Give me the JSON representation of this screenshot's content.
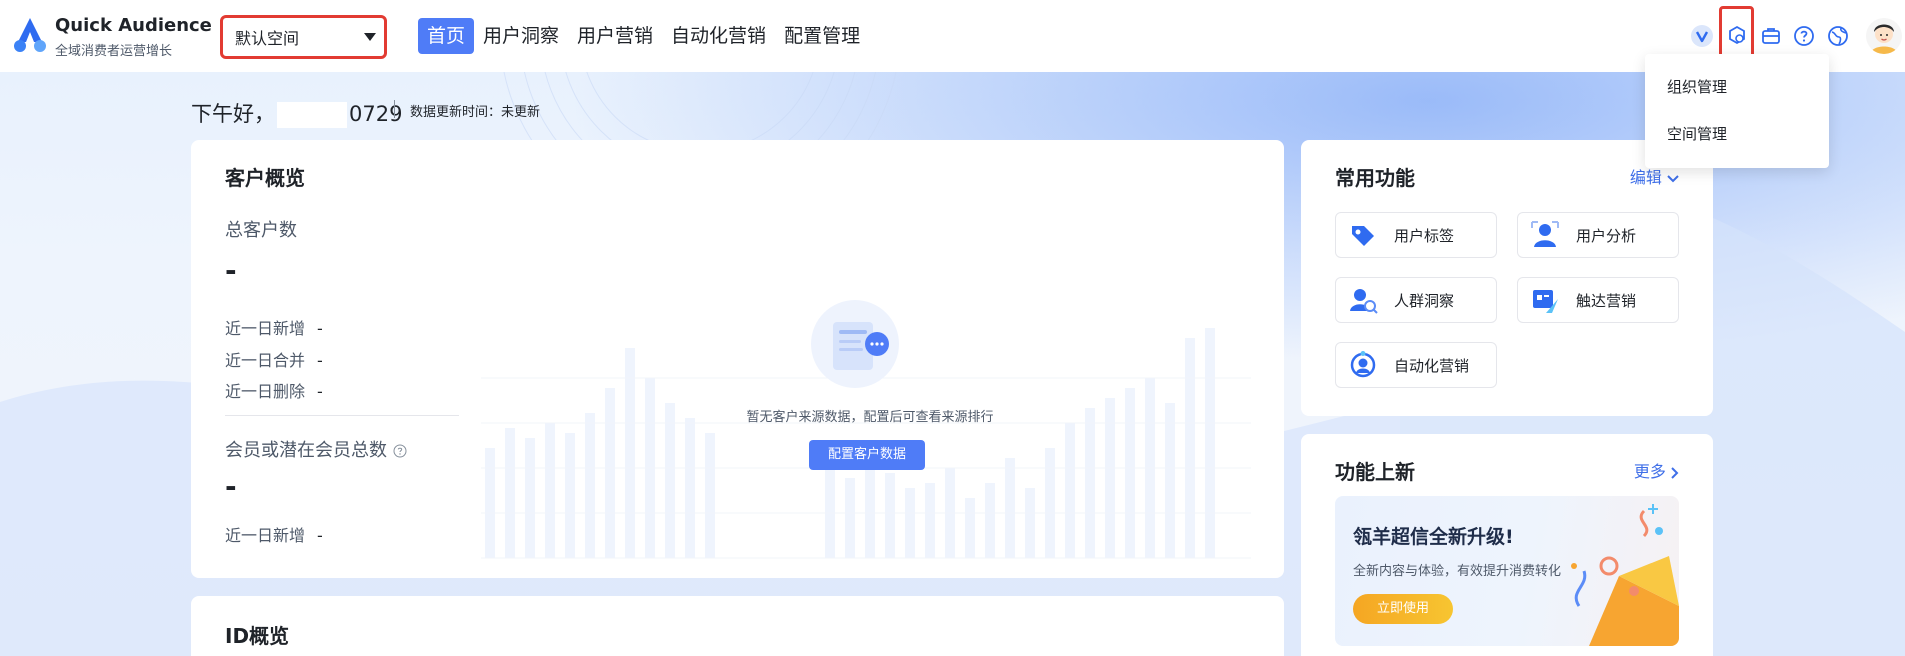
{
  "header": {
    "brand_title": "Quick Audience",
    "brand_sub": "全域消费者运营增长",
    "space_select": "默认空间",
    "nav": [
      "首页",
      "用户洞察",
      "用户营销",
      "自动化营销",
      "配置管理"
    ],
    "active_nav": "首页"
  },
  "dropdown": {
    "items": [
      "组织管理",
      "空间管理"
    ]
  },
  "greeting": {
    "prefix": "下午好，",
    "suffix": "0729",
    "update_time": "数据更新时间：未更新"
  },
  "overview": {
    "title": "客户概览",
    "total_label": "总客户数",
    "total_value": "-",
    "rows": [
      {
        "label": "近一日新增",
        "value": "-"
      },
      {
        "label": "近一日合并",
        "value": "-"
      },
      {
        "label": "近一日删除",
        "value": "-"
      }
    ],
    "member_label": "会员或潜在会员总数",
    "member_value": "-",
    "member_rows": [
      {
        "label": "近一日新增",
        "value": "-"
      }
    ],
    "empty_text": "暂无客户来源数据，配置后可查看来源排行",
    "config_button": "配置客户数据"
  },
  "id_overview": {
    "title": "ID概览"
  },
  "functions": {
    "title": "常用功能",
    "edit_label": "编辑",
    "items": [
      "用户标签",
      "用户分析",
      "人群洞察",
      "触达营销",
      "自动化营销"
    ]
  },
  "new_features": {
    "title": "功能上新",
    "more_label": "更多",
    "banner_title": "瓴羊超信全新升级!",
    "banner_sub": "全新内容与体验，有效提升消费转化",
    "banner_button": "立即使用"
  },
  "colors": {
    "accent": "#4f7cf7",
    "link": "#3f6fe8",
    "highlight_box": "#e23b32"
  }
}
